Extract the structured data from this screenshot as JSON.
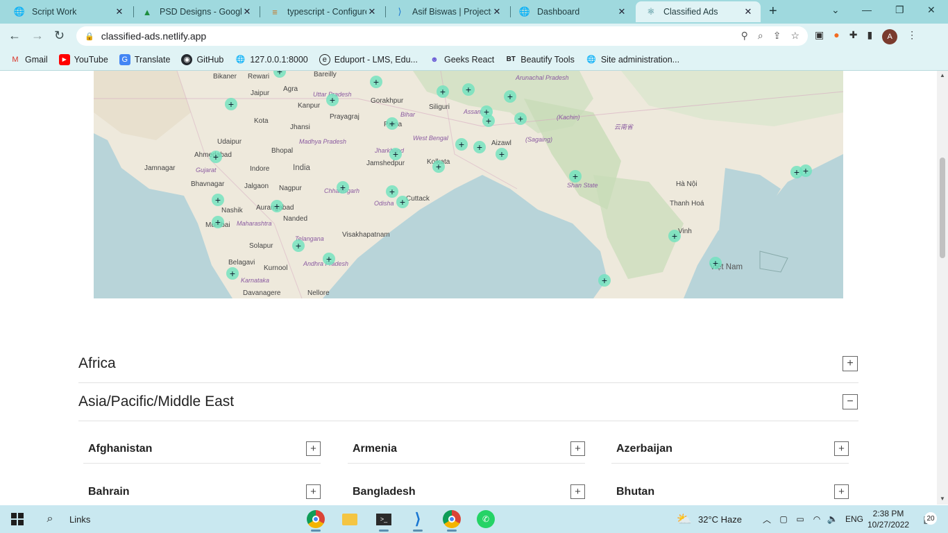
{
  "tabs": [
    {
      "title": "Script Work",
      "icon": "globe-icon"
    },
    {
      "title": "PSD Designs - Google",
      "icon": "google-drive-icon"
    },
    {
      "title": "typescript - Configure",
      "icon": "stackoverflow-icon"
    },
    {
      "title": "Asif Biswas | Projects",
      "icon": "vscode-icon"
    },
    {
      "title": "Dashboard",
      "icon": "globe-icon"
    },
    {
      "title": "Classified Ads",
      "icon": "react-icon"
    }
  ],
  "url": "classified-ads.netlify.app",
  "bookmarks": [
    {
      "label": "Gmail",
      "color": "#d93025"
    },
    {
      "label": "YouTube",
      "color": "#ff0000"
    },
    {
      "label": "Translate",
      "color": "#4285f4"
    },
    {
      "label": "GitHub",
      "color": "#24292f"
    },
    {
      "label": "127.0.0.1:8000",
      "color": "#202124"
    },
    {
      "label": "Eduport - LMS, Edu...",
      "color": "#202124"
    },
    {
      "label": "Geeks React",
      "color": "#6b5bd6"
    },
    {
      "label": "Beautify Tools",
      "color": "#202124"
    },
    {
      "label": "Site administration...",
      "color": "#202124"
    }
  ],
  "profile_initial": "A",
  "map_labels": {
    "bikaner": "Bikaner",
    "rewari": "Rewari",
    "bareilly": "Bareilly",
    "agra": "Agra",
    "jaipur": "Jaipur",
    "uttar_pradesh": "Uttar Pradesh",
    "gorakhpur": "Gorakhpur",
    "kanpur": "Kanpur",
    "siliguri": "Siliguri",
    "prayagraj": "Prayagraj",
    "kota": "Kota",
    "jhansi": "Jhansi",
    "bihar": "Bihar",
    "patna": "Patna",
    "udaipur": "Udaipur",
    "madhya_pradesh": "Madhya Pradesh",
    "west_bengal": "West Bengal",
    "ahmedabad": "Ahmedabad",
    "bhopal": "Bhopal",
    "jharkhand": "Jharkhand",
    "jamnagar": "Jamnagar",
    "gujarat": "Gujarat",
    "indore": "Indore",
    "india": "India",
    "jamshedpur": "Jamshedpur",
    "kolkata": "Kolkata",
    "bhavnagar": "Bhavnagar",
    "jalgaon": "Jalgaon",
    "nagpur": "Nagpur",
    "chhattisgarh": "Chhattisgarh",
    "nashik": "Nashik",
    "aurangabad": "Aurangabad",
    "odisha": "Odisha",
    "cuttack": "Cuttack",
    "mumbai": "Mumbai",
    "maharashtra": "Maharashtra",
    "nanded": "Nanded",
    "telangana": "Telangana",
    "visakhapatnam": "Visakhapatnam",
    "solapur": "Solapur",
    "belagavi": "Belagavi",
    "kurnool": "Kurnool",
    "andhra_pradesh": "Andhra Pradesh",
    "karnataka": "Karnataka",
    "davanagere": "Davanagere",
    "nellore": "Nellore",
    "arunachal": "Arunachal Pradesh",
    "assam": "Assam",
    "aizawl": "Aizawl",
    "sagaing": "(Sagaing)",
    "kachin": "(Kachin)",
    "shan_state": "Shan State",
    "ha_noi": "Hà Nội",
    "thanh_hoa": "Thanh Hoá",
    "vinh": "Vinh",
    "viet_nam": "Việt Nam",
    "yunnan": "云南省"
  },
  "sections": [
    {
      "title": "Africa",
      "state": "collapsed"
    },
    {
      "title": "Asia/Pacific/Middle East",
      "state": "expanded"
    }
  ],
  "countries": [
    "Afghanistan",
    "Armenia",
    "Azerbaijan",
    "Bahrain",
    "Bangladesh",
    "Bhutan"
  ],
  "taskbar": {
    "search_label": "Links",
    "weather": "32°C  Haze",
    "language": "ENG",
    "time": "2:38 PM",
    "date": "10/27/2022",
    "notifications": "20"
  }
}
